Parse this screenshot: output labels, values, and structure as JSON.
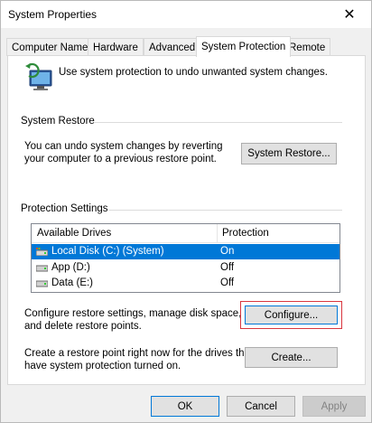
{
  "window": {
    "title": "System Properties",
    "close_glyph": "✕"
  },
  "tabs": [
    {
      "label": "Computer Name",
      "active": false
    },
    {
      "label": "Hardware",
      "active": false
    },
    {
      "label": "Advanced",
      "active": false
    },
    {
      "label": "System Protection",
      "active": true
    },
    {
      "label": "Remote",
      "active": false
    }
  ],
  "intro": {
    "text": "Use system protection to undo unwanted system changes.",
    "icon": "computer-shield-icon"
  },
  "system_restore": {
    "group_label": "System Restore",
    "desc_line1": "You can undo system changes by reverting",
    "desc_line2": "your computer to a previous restore point.",
    "button_label": "System Restore..."
  },
  "protection": {
    "group_label": "Protection Settings",
    "columns": [
      "Available Drives",
      "Protection"
    ],
    "drives": [
      {
        "name": "Local Disk (C:) (System)",
        "protection": "On",
        "selected": true,
        "icon": "system-drive-icon"
      },
      {
        "name": "App (D:)",
        "protection": "Off",
        "selected": false,
        "icon": "drive-icon"
      },
      {
        "name": "Data (E:)",
        "protection": "Off",
        "selected": false,
        "icon": "drive-icon"
      }
    ],
    "configure_desc_line1": "Configure restore settings, manage disk space,",
    "configure_desc_line2": "and delete restore points.",
    "configure_label": "Configure...",
    "create_desc_line1": "Create a restore point right now for the drives that",
    "create_desc_line2": "have system protection turned on.",
    "create_label": "Create..."
  },
  "footer": {
    "ok_label": "OK",
    "cancel_label": "Cancel",
    "apply_label": "Apply"
  },
  "colors": {
    "selection": "#0078d7",
    "focus_frame": "#d9363e",
    "button_face": "#e1e1e1"
  }
}
